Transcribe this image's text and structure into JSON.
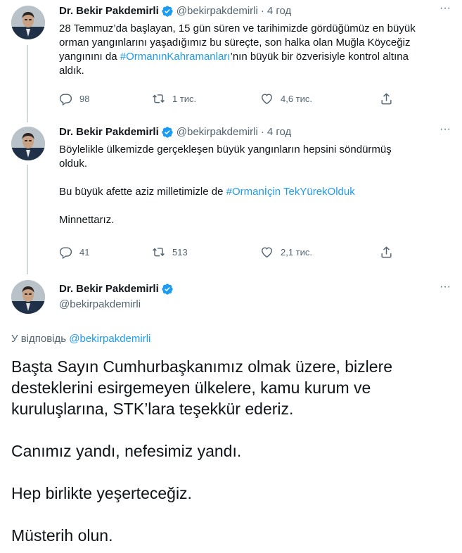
{
  "tweets": [
    {
      "name": "Dr. Bekir Pakdemirli",
      "handle": "@bekirpakdemirli",
      "sep": "·",
      "time": "4 год",
      "lines": [
        "28 Temmuz’da başlayan, 15 gün süren ve tarihimizde gördüğümüz en büyük",
        "orman yangınlarını yaşadığımız bu süreçte, son halka olan Muğla Köyceğiz"
      ],
      "line3_pre": "yangınını da ",
      "line3_tag": "#OrmanınKahramanları",
      "line3_post": "’nın büyük bir özverisiyle kontrol altına",
      "line4": "aldık.",
      "replies": "98",
      "retweets": "1 тис.",
      "likes": "4,6 тис."
    },
    {
      "name": "Dr. Bekir Pakdemirli",
      "handle": "@bekirpakdemirli",
      "sep": "·",
      "time": "4 год",
      "line1": "Böylelikle ülkemizde gerçekleşen büyük yangınların hepsini söndürmüş",
      "line2": "olduk.",
      "line3_pre": "Bu büyük afette aziz milletimizle de ",
      "line3_tag": "#Ormanİçin TekYürekOlduk",
      "line4": "Minnettarız.",
      "replies": "41",
      "retweets": "513",
      "likes": "2,1 тис."
    }
  ],
  "main": {
    "name": "Dr. Bekir Pakdemirli",
    "handle": "@bekirpakdemirli",
    "reply_prefix": "У відповідь ",
    "reply_mention": "@bekirpakdemirli",
    "paragraphs": [
      "Başta Sayın Cumhurbaşkanımız olmak üzere, bizlere",
      "desteklerini esirgemeyen ülkelere, kamu kurum ve",
      "kuruluşlarına, STK’lara teşekkür ederiz.",
      "Canımız yandı, nefesimiz yandı.",
      "Hep birlikte yeşerteceğiz.",
      "Müsterih olun."
    ]
  },
  "icons": {
    "more": "more-icon",
    "verified": "verified-badge-icon",
    "reply": "reply-icon",
    "retweet": "retweet-icon",
    "like": "like-icon",
    "share": "share-icon"
  },
  "colors": {
    "accent": "#1d9bf0",
    "muted": "#536471",
    "text": "#0f1419",
    "thread_line": "#cfd9de"
  }
}
